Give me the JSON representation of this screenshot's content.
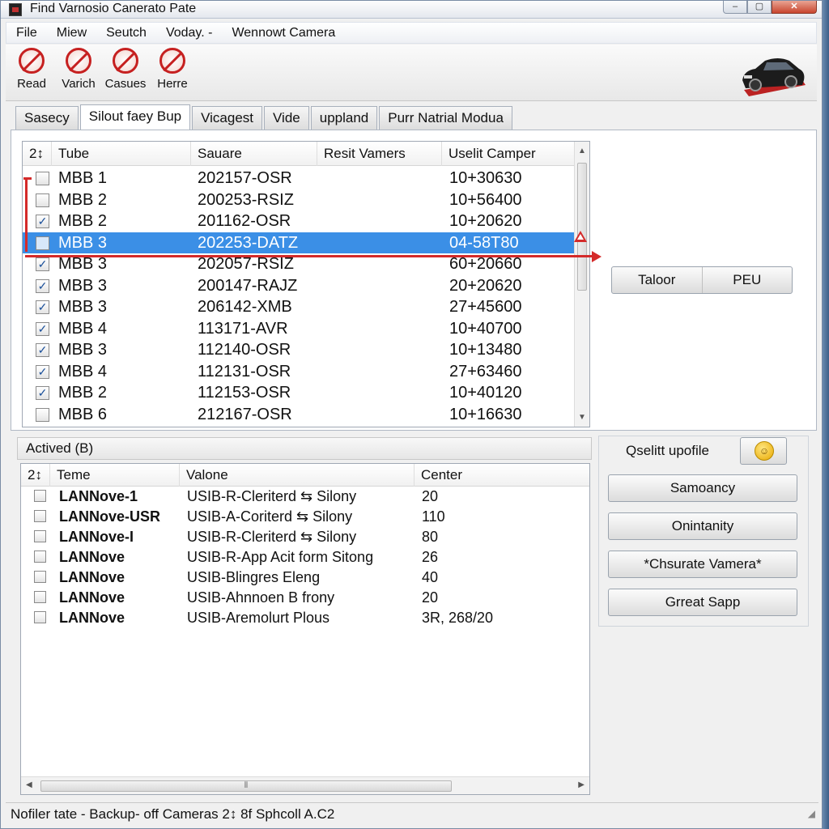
{
  "window": {
    "title": "Find Varnosio Canerato Pate",
    "controls": [
      "–",
      "▢",
      "✕"
    ]
  },
  "menu": [
    "File",
    "Miew",
    "Seutch",
    "Voday. -",
    "Wennowt Camera"
  ],
  "toolbar": [
    {
      "label": "Read",
      "icon": "no-sign-icon"
    },
    {
      "label": "Varich",
      "icon": "no-sign-icon"
    },
    {
      "label": "Casues",
      "icon": "no-sign-icon"
    },
    {
      "label": "Herre",
      "icon": "no-sign-icon"
    }
  ],
  "tabs": [
    "Sasecy",
    "Silout faey Bup",
    "Vicagest",
    "Vide",
    "uppland",
    "Purr Natrial Modua"
  ],
  "active_tab_index": 1,
  "top_list": {
    "headers": [
      "2↕",
      "Tube",
      "Sauare",
      "Resit Vamers",
      "Uselit Camper"
    ],
    "rows": [
      {
        "checked": false,
        "tube": "MBB 1",
        "sauare": "202157-OSR",
        "camper": "10+30630"
      },
      {
        "checked": false,
        "tube": "MBB 2",
        "sauare": "200253-RSIZ",
        "camper": "10+56400"
      },
      {
        "checked": true,
        "tube": "MBB 2",
        "sauare": "201162-OSR",
        "camper": "10+20620"
      },
      {
        "checked": false,
        "tube": "MBB 3",
        "sauare": "202253-DATZ",
        "camper": "04-58T80",
        "selected": true
      },
      {
        "checked": true,
        "tube": "MBB 3",
        "sauare": "202057-RSIZ",
        "camper": "60+20660"
      },
      {
        "checked": true,
        "tube": "MBB 3",
        "sauare": "200147-RAJZ",
        "camper": "20+20620"
      },
      {
        "checked": true,
        "tube": "MBB 3",
        "sauare": "206142-XMB",
        "camper": "27+45600"
      },
      {
        "checked": true,
        "tube": "MBB 4",
        "sauare": "113171-AVR",
        "camper": "10+40700"
      },
      {
        "checked": true,
        "tube": "MBB 3",
        "sauare": "112140-OSR",
        "camper": "10+13480"
      },
      {
        "checked": true,
        "tube": "MBB 4",
        "sauare": "112131-OSR",
        "camper": "27+63460"
      },
      {
        "checked": true,
        "tube": "MBB 2",
        "sauare": "112153-OSR",
        "camper": "10+40120"
      },
      {
        "checked": false,
        "tube": "MBB 6",
        "sauare": "212167-OSR",
        "camper": "10+16630"
      }
    ]
  },
  "split_button": {
    "left": "Taloor",
    "right": "PEU"
  },
  "section_label": "Actived (B)",
  "bottom_list": {
    "headers": [
      "2↕",
      "Teme",
      "Valone",
      "Center"
    ],
    "rows": [
      {
        "checked": false,
        "teme": "LANNove-1",
        "valone": "USIB-R-Cleriterd ⇆ Silony",
        "center": "20"
      },
      {
        "checked": false,
        "teme": "LANNove-USR",
        "valone": "USIB-A-Coriterd ⇆ Silony",
        "center": "110"
      },
      {
        "checked": false,
        "teme": "LANNove-I",
        "valone": "USIB-R-Cleriterd ⇆ Silony",
        "center": "80"
      },
      {
        "checked": false,
        "teme": "LANNove",
        "valone": "USIB-R-App Acit form Sitong",
        "center": "26"
      },
      {
        "checked": false,
        "teme": "LANNove",
        "valone": "USIB-Blingres Eleng",
        "center": "40"
      },
      {
        "checked": false,
        "teme": "LANNove",
        "valone": "USIB-Ahnnoen B frony",
        "center": "20"
      },
      {
        "checked": false,
        "teme": "LANNove",
        "valone": "USIB-Aremolurt Plous",
        "center": "3R, 268/20"
      }
    ]
  },
  "side_panel": {
    "title": "Qselitt upofile",
    "icon": "smiley-icon",
    "buttons": [
      "Samoancy",
      "Onintanity",
      "*Chsurate Vamera*",
      "Grreat Sapp"
    ]
  },
  "status": "Nofiler tate - Backup- off Cameras 2↕ 8f Sphcoll A.C2",
  "colors": {
    "selection": "#3b8fe6",
    "annotation_red": "#d42a2a"
  }
}
